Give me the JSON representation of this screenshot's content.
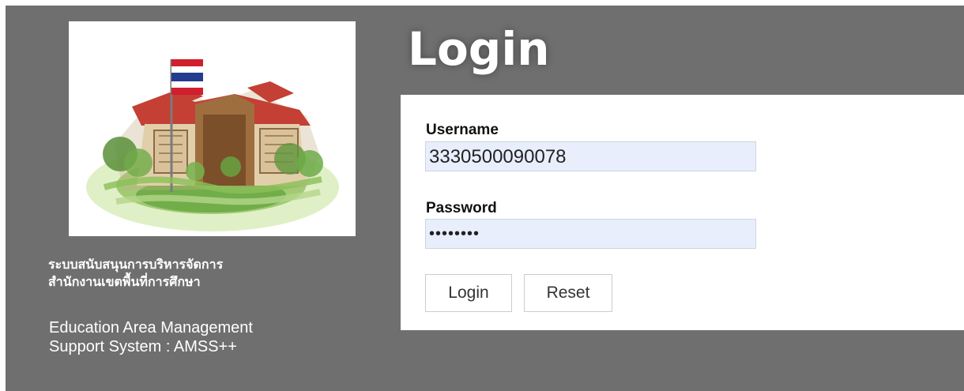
{
  "page": {
    "title": "Login"
  },
  "branding": {
    "image_alt": "School building illustration with flag",
    "thai_line_1": "ระบบสนับสนุนการบริหารจัดการ",
    "thai_line_2": "สำนักงานเขตพื้นที่การศึกษา",
    "english_line_1": "Education Area Management",
    "english_line_2": "Support System : AMSS++"
  },
  "form": {
    "username_label": "Username",
    "username_value": "3330500090078",
    "password_label": "Password",
    "password_value": "12345678",
    "login_button": "Login",
    "reset_button": "Reset"
  },
  "colors": {
    "panel_background": "#6f6f6f",
    "input_background": "#e8eefb",
    "input_border": "#cfd4df",
    "button_border": "#cccccc",
    "text_dark": "#111111",
    "white": "#ffffff"
  }
}
